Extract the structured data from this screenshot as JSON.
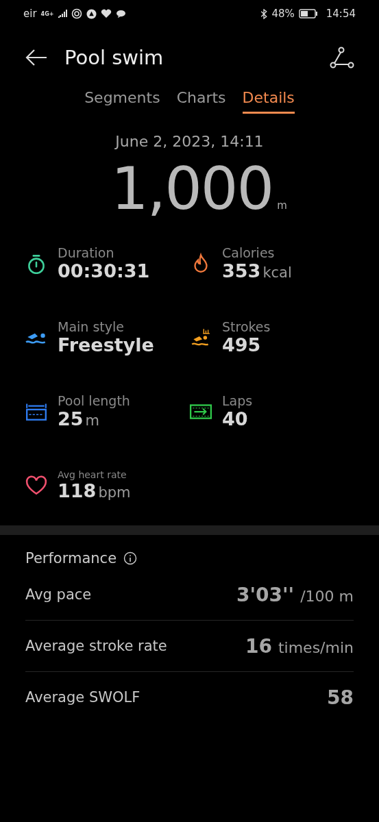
{
  "status_bar": {
    "carrier": "eir",
    "network": "4G+",
    "battery": "48%",
    "time": "14:54"
  },
  "header": {
    "title": "Pool swim"
  },
  "tabs": [
    {
      "label": "Segments",
      "selected": false
    },
    {
      "label": "Charts",
      "selected": false
    },
    {
      "label": "Details",
      "selected": true
    }
  ],
  "summary": {
    "date": "June 2, 2023, 14:11",
    "distance": "1,000",
    "unit": "m"
  },
  "stats": [
    {
      "kind": "stopwatch",
      "color": "#3ecf9a",
      "label": "Duration",
      "value": "00:30:31"
    },
    {
      "kind": "flame",
      "color": "#f0783c",
      "label": "Calories",
      "value": "353",
      "unit": "kcal"
    },
    {
      "kind": "swimmer",
      "color": "#3d9cf5",
      "label": "Main style",
      "value": "Freestyle"
    },
    {
      "kind": "strokes",
      "color": "#f5a020",
      "label": "Strokes",
      "value": "495"
    },
    {
      "kind": "pool",
      "color": "#2f7cf0",
      "label": "Pool length",
      "value": "25",
      "unit": "m"
    },
    {
      "kind": "laps",
      "color": "#2fc84a",
      "label": "Laps",
      "value": "40"
    },
    {
      "kind": "heart",
      "color": "#f0506e",
      "label": "Avg heart rate",
      "value": "118",
      "unit": "bpm",
      "small_label": true
    }
  ],
  "performance": {
    "title": "Performance",
    "rows": [
      {
        "label": "Avg pace",
        "value": "3'03''",
        "unit": "/100 m"
      },
      {
        "label": "Average stroke rate",
        "value": "16",
        "unit": "times/min"
      },
      {
        "label": "Average SWOLF",
        "value": "58"
      }
    ]
  }
}
